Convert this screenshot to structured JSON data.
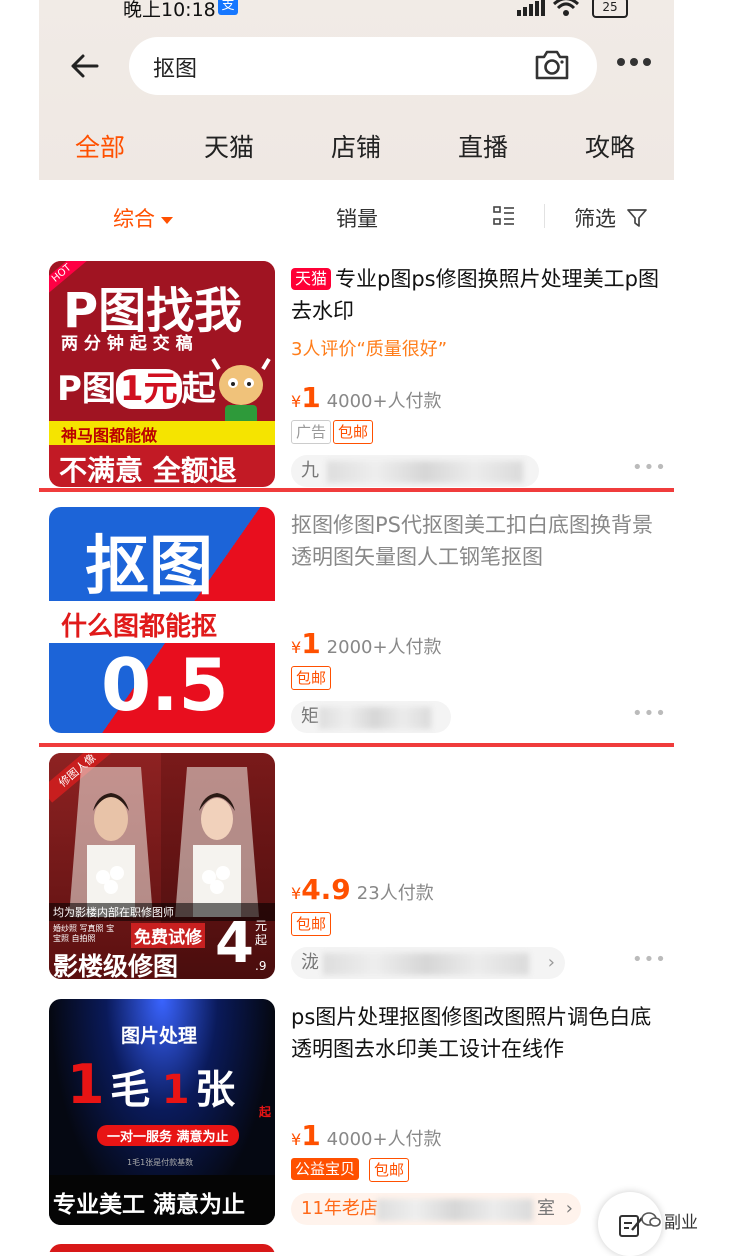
{
  "status": {
    "time": "晚上10:18",
    "pay_badge": "支",
    "battery": "25"
  },
  "search": {
    "query": "抠图"
  },
  "tabs": [
    {
      "label": "全部",
      "active": true
    },
    {
      "label": "天猫"
    },
    {
      "label": "店铺"
    },
    {
      "label": "直播"
    },
    {
      "label": "攻略"
    }
  ],
  "sortbar": {
    "comprehensive": "综合",
    "sales": "销量",
    "filter": "筛选"
  },
  "products": [
    {
      "badge": "天猫",
      "title": "专业p图ps修图换照片处理美工p图去水印",
      "rating": "3人评价“质量很好”",
      "currency": "¥",
      "price": "1",
      "sold": "4000+人付款",
      "tags": [
        "广告",
        "包邮"
      ],
      "store_prefix": "九",
      "thumb": {
        "hot": "HOT",
        "line1": "P图找我",
        "line2": "两 分 钟 起 交 稿",
        "line3a": "P图",
        "line3b": "1元",
        "line3c": "起",
        "line4": "神马图都能做",
        "line5": "不满意 全额退"
      }
    },
    {
      "title": "抠图修图PS代抠图美工扣白底图换背景透明图矢量图人工钢笔抠图",
      "currency": "¥",
      "price": "1",
      "sold": "2000+人付款",
      "tags": [
        "包邮"
      ],
      "store_prefix": "矩",
      "thumb": {
        "line1": "抠图",
        "line2": "什么图都能抠",
        "line3": "0.5"
      }
    },
    {
      "currency": "¥",
      "price": "4.9",
      "sold": "23人付款",
      "tags": [
        "包邮"
      ],
      "store_prefix": "泷",
      "thumb": {
        "corner": "修图人像",
        "caption": "均为影楼内部在职修图师",
        "small": "婚纱照 写真照 宝宝照 自拍照",
        "promo": "免费试修",
        "bottom": "影楼级修图",
        "price": "4",
        "unit": "元起",
        "decimal": ".9"
      }
    },
    {
      "title": "ps图片处理抠图修图改图照片调色白底透明图去水印美工设计在线作",
      "currency": "¥",
      "price": "1",
      "sold": "4000+人付款",
      "tags": [
        "公益宝贝",
        "包邮"
      ],
      "store_prefix": "11年老店",
      "store_suffix": "室",
      "thumb": {
        "top": "图片处理",
        "mid_a": "1",
        "mid_b": "毛",
        "mid_c": "1",
        "mid_d": "张",
        "mid_e": "起",
        "pill": "一对一服务 满意为止",
        "note": "1毛1张是付款基数",
        "bottom": "专业美工 满意为止"
      }
    }
  ],
  "watermark": "副业"
}
